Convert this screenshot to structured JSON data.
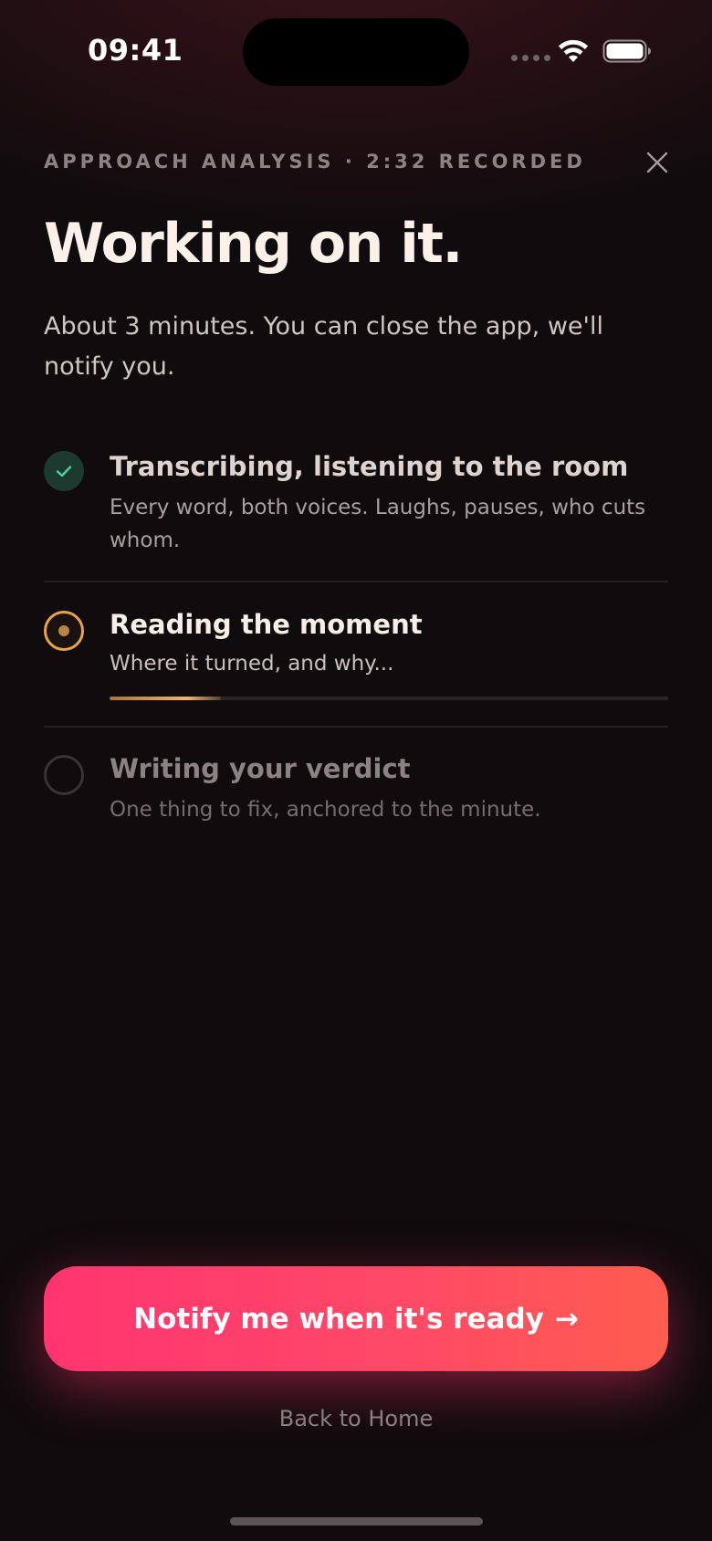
{
  "status_bar": {
    "time": "09:41",
    "icons": [
      "signal-dots-icon",
      "wifi-icon",
      "battery-icon"
    ]
  },
  "header": {
    "eyebrow": "APPROACH ANALYSIS · 2:32 RECORDED",
    "close_icon": "close-icon",
    "title": "Working on it.",
    "subtitle": "About 3 minutes. You can close the app, we'll notify you."
  },
  "steps": [
    {
      "state": "done",
      "title": "Transcribing, listening to the room",
      "description": "Every word, both voices. Laughs, pauses, who cuts whom.",
      "icon": "check-icon"
    },
    {
      "state": "active",
      "title": "Reading the moment",
      "description": "Where it turned, and why...",
      "icon": "radio-active-icon",
      "progress": 0.2
    },
    {
      "state": "pending",
      "title": "Writing your verdict",
      "description": "One thing to fix, anchored to the minute.",
      "icon": "radio-empty-icon"
    }
  ],
  "actions": {
    "notify_label": "Notify me when it's ready",
    "notify_arrow": "→",
    "back_label": "Back to Home"
  },
  "colors": {
    "background": "#100b0d",
    "accent_gradient_start": "#ff3470",
    "accent_gradient_end": "#ff5c4f",
    "active_step": "#e8a24a",
    "done_step": "#1d3a30",
    "check": "#4fd0a0"
  }
}
